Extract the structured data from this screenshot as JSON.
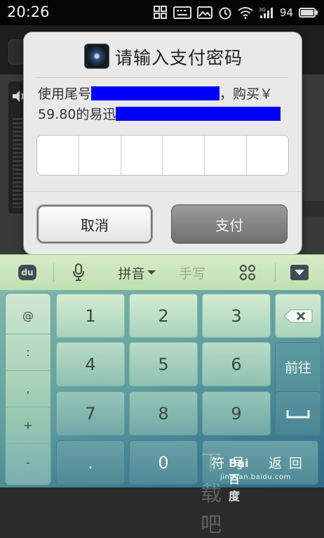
{
  "status_bar": {
    "time": "20:26",
    "battery_percent": "94",
    "network_label": "3G"
  },
  "dialog": {
    "title": "请输入支付密码",
    "message_part1": "使用尾号",
    "message_part2": "，购买￥",
    "message_part3": "59.80的易迅",
    "pin_cells": 6,
    "cancel_label": "取消",
    "pay_label": "支付"
  },
  "keyboard": {
    "toolbar": {
      "pinyin_label": "拼音",
      "handwrite_label": "手写"
    },
    "symbols": [
      "@",
      ":",
      ",",
      "+",
      "-"
    ],
    "digits": [
      "1",
      "2",
      "3",
      "4",
      "5",
      "6",
      "7",
      "8",
      "9",
      ".",
      "0"
    ],
    "go_label": "前往",
    "symbol_key_label": "符号",
    "return_key_label": "返回"
  },
  "watermark": {
    "logo": "Bai 百度",
    "site": "jingyan.baidu.com",
    "overlay": "下载吧"
  },
  "colors": {
    "redaction": "#0000ff",
    "keyboard_accent": "#5f9ea0"
  }
}
